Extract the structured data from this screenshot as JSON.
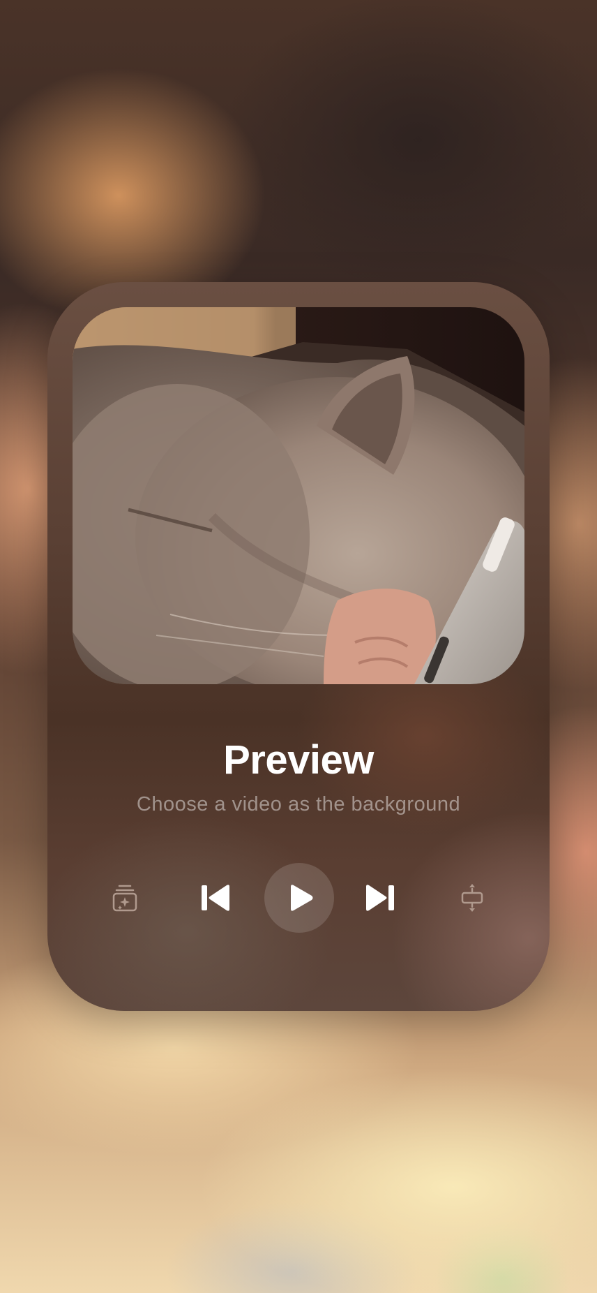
{
  "card": {
    "title": "Preview",
    "subtitle": "Choose a video as the background"
  },
  "controls": [
    {
      "name": "effects-icon",
      "state": "disabled"
    },
    {
      "name": "previous-track-icon",
      "state": "enabled"
    },
    {
      "name": "play-icon",
      "state": "enabled"
    },
    {
      "name": "next-track-icon",
      "state": "enabled"
    },
    {
      "name": "resize-vertical-icon",
      "state": "disabled"
    }
  ],
  "colors": {
    "icon_active": "#ffffff",
    "icon_disabled": "#b09a8e",
    "title": "#ffffff"
  }
}
